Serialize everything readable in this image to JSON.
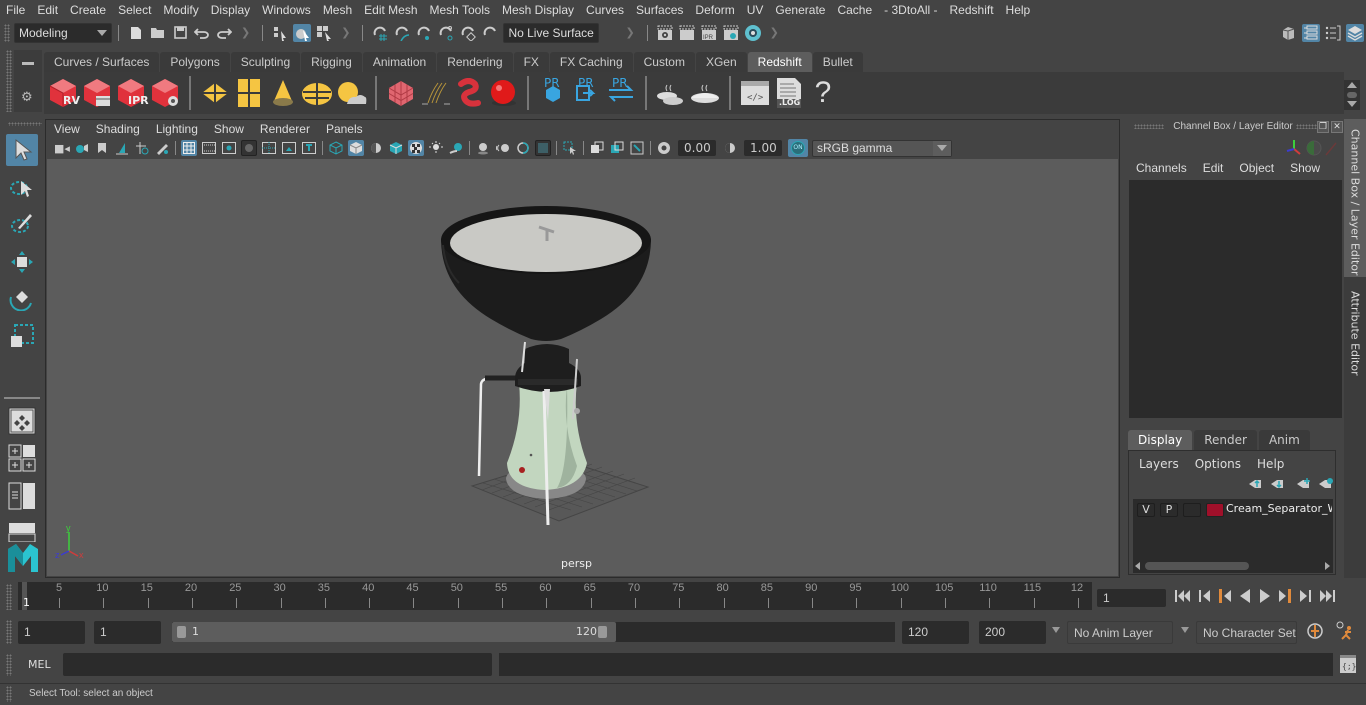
{
  "menubar": {
    "items": [
      "File",
      "Edit",
      "Create",
      "Select",
      "Modify",
      "Display",
      "Windows",
      "Mesh",
      "Edit Mesh",
      "Mesh Tools",
      "Mesh Display",
      "Curves",
      "Surfaces",
      "Deform",
      "UV",
      "Generate",
      "Cache",
      "- 3DtoAll -",
      "Redshift",
      "Help"
    ]
  },
  "statusline": {
    "menu_set": "Modeling",
    "live_surface": "No Live Surface"
  },
  "shelf": {
    "tabs": [
      "Curves / Surfaces",
      "Polygons",
      "Sculpting",
      "Rigging",
      "Animation",
      "Rendering",
      "FX",
      "FX Caching",
      "Custom",
      "XGen",
      "Redshift",
      "Bullet"
    ],
    "active_tab": "Redshift",
    "icon_labels": {
      "rv": "RV",
      "ipr": "IPR",
      "pr": "PR",
      "log": ".LOG",
      "help": "?"
    }
  },
  "viewport_panel": {
    "menus": [
      "View",
      "Shading",
      "Lighting",
      "Show",
      "Renderer",
      "Panels"
    ],
    "exposure": "0.00",
    "gamma": "1.00",
    "color_mgmt_toggle": "ON",
    "color_space": "sRGB gamma",
    "camera": "persp"
  },
  "channel_box": {
    "title": "Channel Box / Layer Editor",
    "menus": [
      "Channels",
      "Edit",
      "Object",
      "Show"
    ]
  },
  "layer_editor": {
    "tabs": [
      "Display",
      "Render",
      "Anim"
    ],
    "active_tab": "Display",
    "menus": [
      "Layers",
      "Options",
      "Help"
    ],
    "layers": [
      {
        "visible": "V",
        "playback": "P",
        "name": "Cream_Separator_With",
        "color": "#a0102a"
      }
    ]
  },
  "side_tabs": [
    "Channel Box / Layer Editor",
    "Attribute Editor"
  ],
  "timeline": {
    "ticks": [
      "5",
      "10",
      "15",
      "20",
      "25",
      "30",
      "35",
      "40",
      "45",
      "50",
      "55",
      "60",
      "65",
      "70",
      "75",
      "80",
      "85",
      "90",
      "95",
      "100",
      "105",
      "110",
      "115",
      "12"
    ],
    "current_frame_marker": "1",
    "current_frame": "1"
  },
  "range": {
    "start_time": "1",
    "playback_start": "1",
    "slider_start": "1",
    "slider_end": "120",
    "playback_end": "120",
    "end_time": "200",
    "anim_layer": "No Anim Layer",
    "character_set": "No Character Set"
  },
  "command_line": {
    "language": "MEL",
    "input": "",
    "output": ""
  },
  "help_line": {
    "text": "Select Tool: select an object"
  },
  "colors": {
    "accent": "#5285a6",
    "redshift_red": "#e0323c",
    "shelf_yellow": "#f5c542",
    "teal": "#2aa7b5",
    "playback_orange": "#e08a3c"
  }
}
